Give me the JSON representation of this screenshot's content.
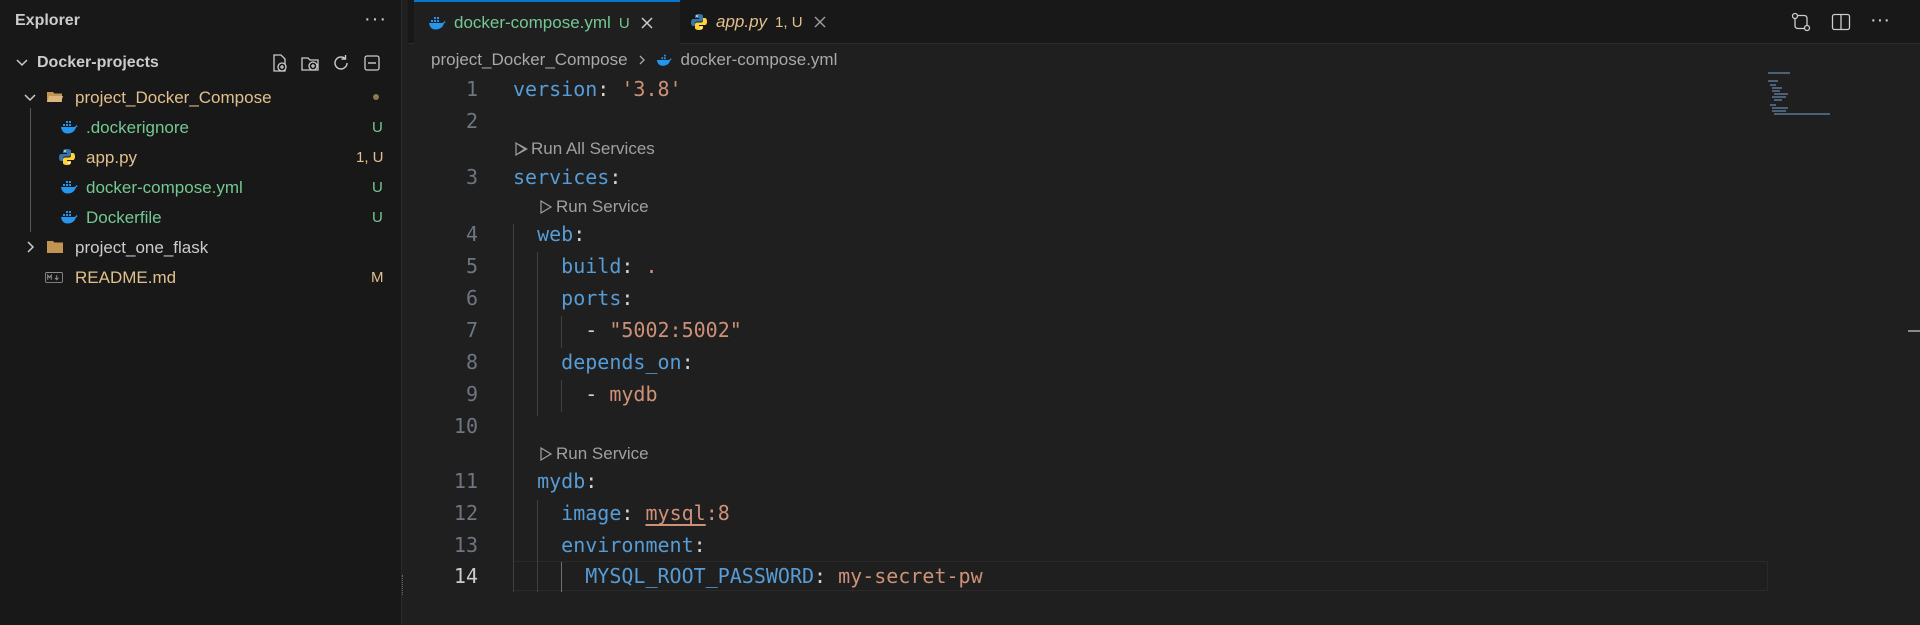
{
  "explorer": {
    "title": "Explorer",
    "more_label": "···",
    "root": {
      "label": "Docker-projects",
      "actions": [
        "new-file-icon",
        "new-folder-icon",
        "refresh-icon",
        "collapse-all-icon"
      ]
    },
    "items": [
      {
        "label": "project_Docker_Compose",
        "badge": "",
        "icon": "folder-open-icon",
        "color": "#e2c08d"
      },
      {
        "label": ".dockerignore",
        "badge": "U",
        "icon": "docker-icon",
        "color": "#73c991"
      },
      {
        "label": "app.py",
        "badge": "1, U",
        "icon": "python-icon",
        "color": "#e2c08d"
      },
      {
        "label": "docker-compose.yml",
        "badge": "U",
        "icon": "docker-icon",
        "color": "#73c991"
      },
      {
        "label": "Dockerfile",
        "badge": "U",
        "icon": "docker-icon",
        "color": "#73c991"
      },
      {
        "label": "project_one_flask",
        "badge": "",
        "icon": "folder-icon",
        "color": "#cccccc"
      },
      {
        "label": "README.md",
        "badge": "M",
        "icon": "markdown-icon",
        "color": "#e2c08d"
      }
    ]
  },
  "tabs": [
    {
      "label": "docker-compose.yml",
      "badge": "U",
      "active": true
    },
    {
      "label": "app.py",
      "badge": "1, U",
      "active": false
    }
  ],
  "breadcrumb": {
    "folder": "project_Docker_Compose",
    "file": "docker-compose.yml"
  },
  "codelens": {
    "run_all": "Run All Services",
    "run_service": "Run Service"
  },
  "code": {
    "line_numbers": [
      "1",
      "2",
      "3",
      "4",
      "5",
      "6",
      "7",
      "8",
      "9",
      "10",
      "11",
      "12",
      "13",
      "14"
    ],
    "l1_key": "version",
    "l1_val": "'3.8'",
    "l3_key": "services",
    "l4_key": "web",
    "l5_key": "build",
    "l5_val": ".",
    "l6_key": "ports",
    "l7_dash": "-",
    "l7_val": "\"5002:5002\"",
    "l8_key": "depends_on",
    "l9_dash": "-",
    "l9_val": "mydb",
    "l11_key": "mydb",
    "l12_key": "image",
    "l12_val_a": "mysql",
    "l12_val_b": ":8",
    "l13_key": "environment",
    "l14_key": "MYSQL_ROOT_PASSWORD",
    "l14_val": "my-secret-pw"
  },
  "colors": {
    "accent": "#0078d4",
    "untracked": "#73c991",
    "modified": "#e2c08d",
    "yaml_key": "#569cd6",
    "yaml_string": "#ce9178"
  }
}
